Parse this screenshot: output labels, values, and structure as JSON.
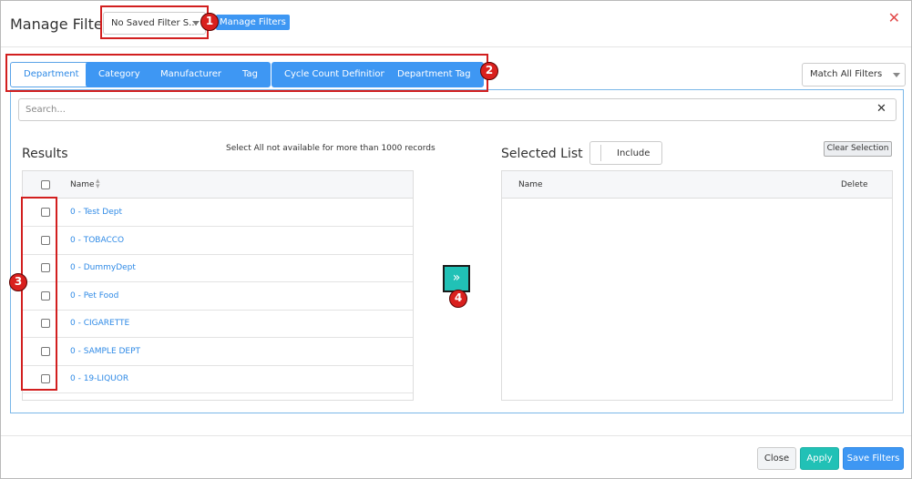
{
  "header": {
    "title": "Manage Filters",
    "saved_filter_value": "No Saved Filter S...",
    "manage_filters_label": "Manage Filters",
    "close_symbol": "✕"
  },
  "tabs": [
    {
      "label": "Department",
      "active": true
    },
    {
      "label": "Category"
    },
    {
      "label": "Manufacturer"
    },
    {
      "label": "Tag"
    },
    {
      "label": "Cycle Count Definition"
    },
    {
      "label": "Department Tag"
    }
  ],
  "match_select": {
    "value": "Match All Filters"
  },
  "search": {
    "placeholder": "Search...",
    "clear_symbol": "✕"
  },
  "results": {
    "title": "Results",
    "note": "Select All not available for more than 1000 records",
    "column_name": "Name",
    "rows": [
      "0 - Test Dept",
      "0 - TOBACCO",
      "0 - DummyDept",
      "0 - Pet Food",
      "0 - CIGARETTE",
      "0 - SAMPLE DEPT",
      "0 - 19-LIQUOR"
    ]
  },
  "move_button": {
    "symbol": "»"
  },
  "selected": {
    "title": "Selected List",
    "include_label": "Include",
    "clear_label": "Clear Selection",
    "column_name": "Name",
    "column_delete": "Delete"
  },
  "footer": {
    "close_label": "Close",
    "apply_label": "Apply",
    "save_label": "Save Filters"
  },
  "callouts": [
    "1",
    "2",
    "3",
    "4"
  ],
  "colors": {
    "primary": "#3e97f3",
    "teal": "#21c1b6",
    "callout_red": "#d9201e"
  }
}
